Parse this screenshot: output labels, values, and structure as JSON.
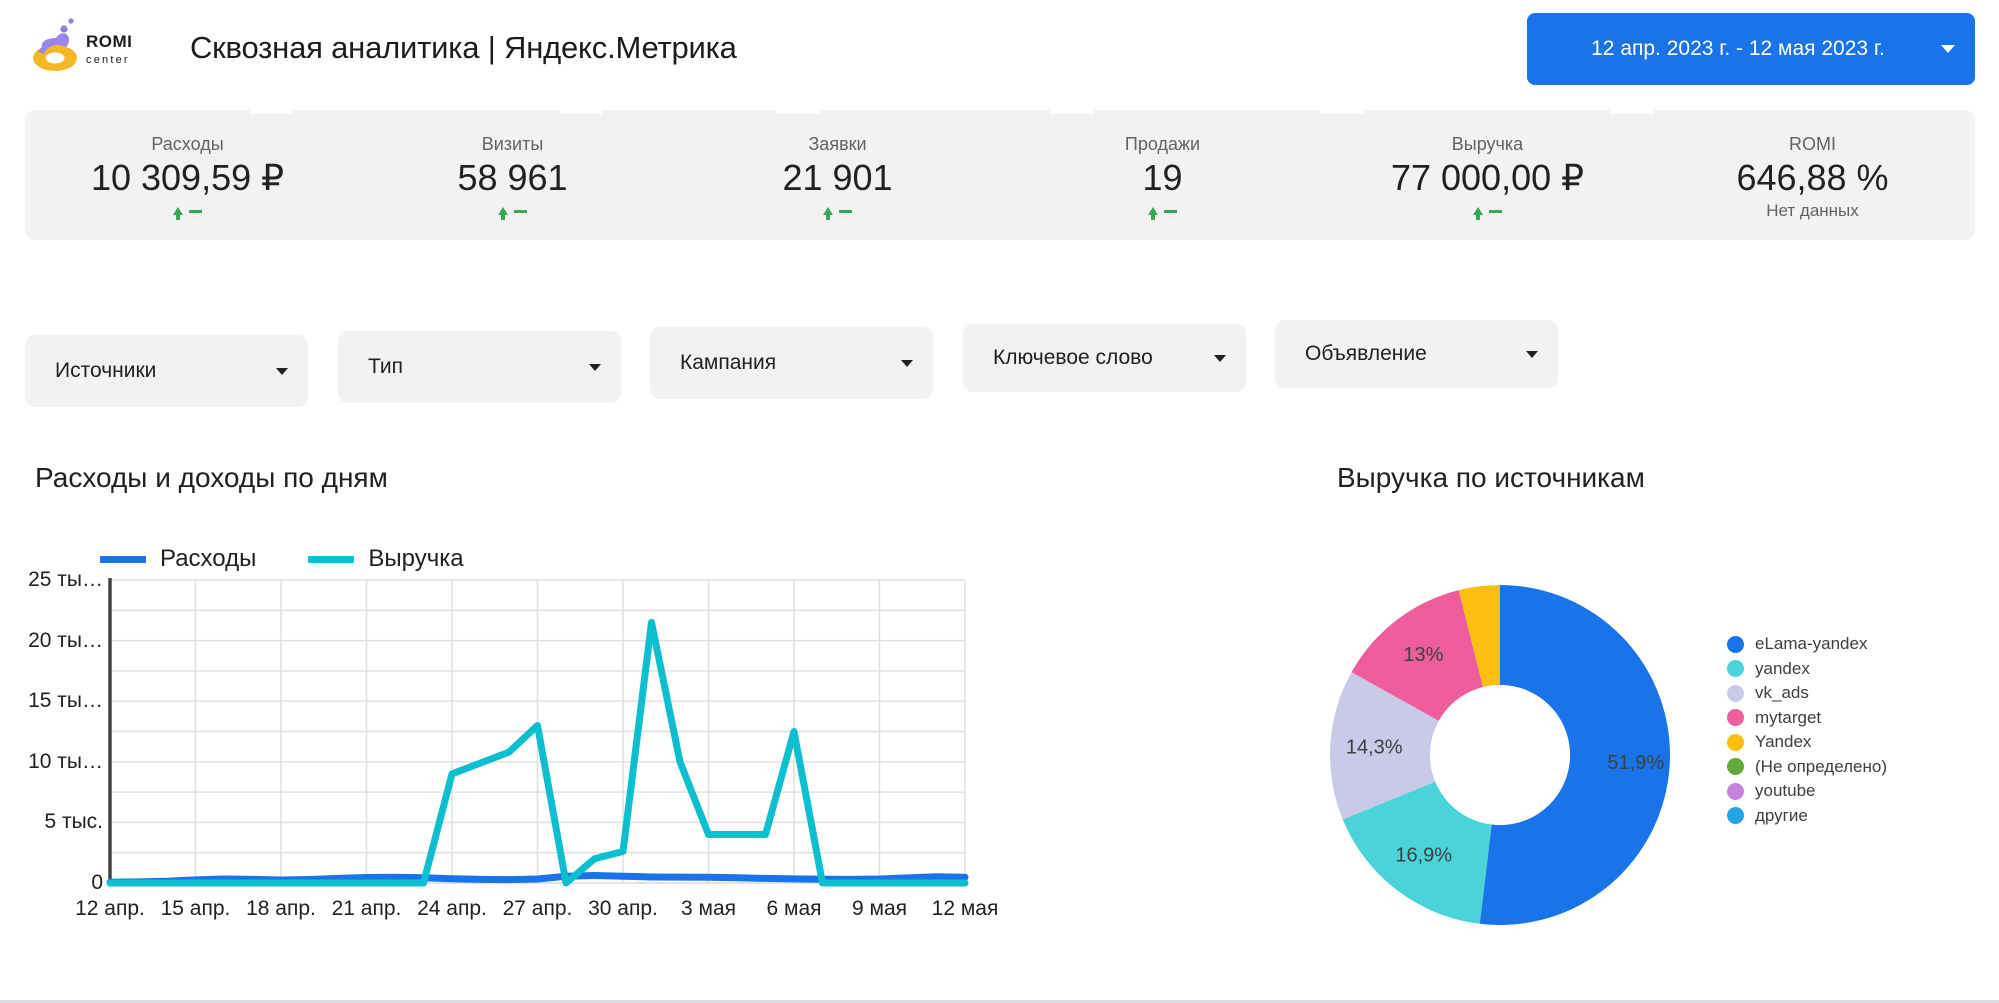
{
  "header": {
    "logo_name": "ROMI center",
    "logo_primary_text": "ROMI",
    "logo_secondary_text": "center",
    "title": "Сквозная аналитика | Яндекс.Метрика",
    "date_range": "12 апр. 2023 г. - 12 мая 2023 г.",
    "date_caret_icon": "chevron-down-icon",
    "accent_color": "#1a73e8"
  },
  "kpis": [
    {
      "label": "Расходы",
      "value": "10 309,59 ₽",
      "delta_icon": "arrow-up-icon",
      "delta": "–",
      "note": ""
    },
    {
      "label": "Визиты",
      "value": "58 961",
      "delta_icon": "arrow-up-icon",
      "delta": "–",
      "note": ""
    },
    {
      "label": "Заявки",
      "value": "21 901",
      "delta_icon": "arrow-up-icon",
      "delta": "–",
      "note": ""
    },
    {
      "label": "Продажи",
      "value": "19",
      "delta_icon": "arrow-up-icon",
      "delta": "–",
      "note": ""
    },
    {
      "label": "Выручка",
      "value": "77 000,00 ₽",
      "delta_icon": "arrow-up-icon",
      "delta": "–",
      "note": ""
    },
    {
      "label": "ROMI",
      "value": "646,88 %",
      "delta_icon": "",
      "delta": "",
      "note": "Нет данных"
    }
  ],
  "kpi_delta_color": "#34a853",
  "filters": [
    {
      "label": "Источники",
      "caret_icon": "chevron-down-icon"
    },
    {
      "label": "Тип",
      "caret_icon": "chevron-down-icon"
    },
    {
      "label": "Кампания",
      "caret_icon": "chevron-down-icon"
    },
    {
      "label": "Ключевое слово",
      "caret_icon": "chevron-down-icon"
    },
    {
      "label": "Объявление",
      "caret_icon": "chevron-down-icon"
    }
  ],
  "chart_data": [
    {
      "type": "line",
      "title": "Расходы и доходы по дням",
      "xlabel": "",
      "ylabel": "",
      "ylim": [
        0,
        25000
      ],
      "grid": true,
      "legend_position": "top-left",
      "y_ticks": [
        "0",
        "5 тыс.",
        "10 ты…",
        "15 ты…",
        "20 ты…",
        "25 ты…"
      ],
      "y_tick_values": [
        0,
        5000,
        10000,
        15000,
        20000,
        25000
      ],
      "x_ticks": [
        "12 апр.",
        "15 апр.",
        "18 апр.",
        "21 апр.",
        "24 апр.",
        "27 апр.",
        "30 апр.",
        "3 мая",
        "6 мая",
        "9 мая",
        "12 мая"
      ],
      "x": [
        "12 апр.",
        "13 апр.",
        "14 апр.",
        "15 апр.",
        "16 апр.",
        "17 апр.",
        "18 апр.",
        "19 апр.",
        "20 апр.",
        "21 апр.",
        "22 апр.",
        "23 апр.",
        "24 апр.",
        "25 апр.",
        "26 апр.",
        "27 апр.",
        "28 апр.",
        "29 апр.",
        "30 апр.",
        "1 мая",
        "2 мая",
        "3 мая",
        "4 мая",
        "5 мая",
        "6 мая",
        "7 мая",
        "8 мая",
        "9 мая",
        "10 мая",
        "11 мая",
        "12 мая"
      ],
      "series": [
        {
          "name": "Расходы",
          "color": "#1a73e8",
          "values": [
            60,
            90,
            140,
            260,
            330,
            300,
            250,
            290,
            380,
            450,
            470,
            430,
            350,
            300,
            280,
            330,
            560,
            620,
            560,
            500,
            480,
            470,
            430,
            380,
            340,
            310,
            300,
            330,
            420,
            520,
            470
          ]
        },
        {
          "name": "Выручка",
          "color": "#0bbfce",
          "values": [
            0,
            0,
            0,
            0,
            0,
            0,
            0,
            0,
            0,
            0,
            0,
            0,
            9000,
            9900,
            10800,
            13000,
            0,
            2000,
            2600,
            21500,
            10000,
            4000,
            4000,
            4000,
            12500,
            0,
            0,
            0,
            0,
            0,
            0
          ]
        }
      ]
    },
    {
      "type": "pie",
      "title": "Выручка по источникам",
      "donut": true,
      "legend_position": "right",
      "labels": [
        "eLama-yandex",
        "yandex",
        "vk_ads",
        "mytarget",
        "Yandex",
        "(Не определено)",
        "youtube",
        "другие"
      ],
      "values": [
        51.9,
        16.9,
        14.3,
        13,
        3.9,
        0,
        0,
        0
      ],
      "value_labels": [
        "51,9%",
        "16,9%",
        "14,3%",
        "13%",
        "",
        "",
        "",
        ""
      ],
      "colors": [
        "#1a73e8",
        "#4ad3d8",
        "#c9c9e8",
        "#ef5e9c",
        "#fcbf11",
        "#63a83a",
        "#c683dd",
        "#23a5eb"
      ]
    }
  ],
  "icons": {
    "chevron_down": "chevron-down-icon",
    "arrow_up": "arrow-up-icon"
  }
}
